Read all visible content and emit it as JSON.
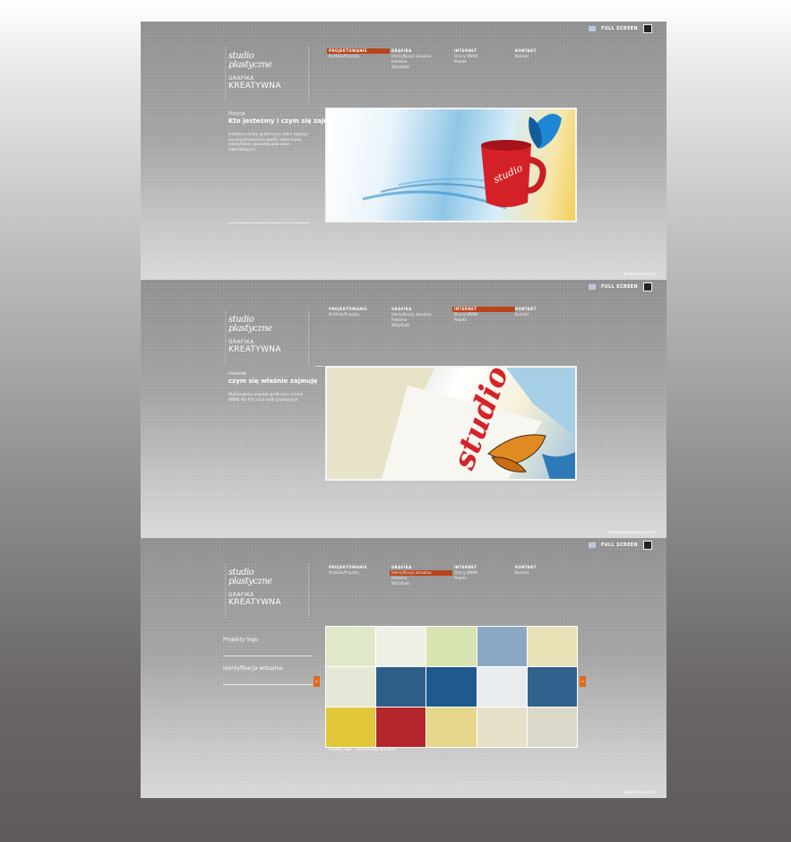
{
  "header": {
    "fullscreen_label": "FULL SCREEN"
  },
  "logo": {
    "script_line1": "studio",
    "script_line2": "plastyczne",
    "line1": "GRAFIKA",
    "line2": "KREATYWNA"
  },
  "nav": {
    "columns": [
      {
        "head": "PROJEKTOWANIE",
        "items": [
          "Portfolio/Projekty"
        ]
      },
      {
        "head": "GRAFIKA",
        "items": [
          "Identyfikacja wizualna",
          "Reklama",
          "Wizytówki"
        ]
      },
      {
        "head": "INTERNET",
        "items": [
          "Strony WWW",
          "Projekt"
        ]
      },
      {
        "head": "KONTAKT",
        "items": [
          "Kontakt"
        ]
      }
    ]
  },
  "panel1": {
    "kicker": "Pozycje",
    "title": "Kto jesteśmy i czym się zajmujemy",
    "body": "Jesteśmy studio graficznym, które zajmuje się projektowaniem grafiki reklamowej, identyfikacji wizualnej oraz stron internetowych.",
    "footer": "ISupra/Vincent/Cz"
  },
  "panel2": {
    "kicker": "Internet",
    "title": "czym się właśnie zajmuję",
    "body": "Wykonujemy projekty graficzne i strony WWW dla firm oraz osób prywatnych.",
    "footer": "kontakt@studioplastyczne"
  },
  "panel3": {
    "menu": [
      "Projekty logo",
      "Identyfikacja wizualna"
    ],
    "caption": "Projekty logo - identyfikacja wizualna",
    "footer": "ISupra/Vincent/Cz"
  },
  "colors": {
    "accent": "#b8441b",
    "arrow": "#e06a1a"
  },
  "gallery_tiles": [
    "#dfe9c8",
    "#eef0e6",
    "#d8e3b2",
    "#8aa8c2",
    "#e8e2b6",
    "#e4e8d6",
    "#2e5f88",
    "#1e5a8c",
    "#e8ecef",
    "#2f628c",
    "#e2c73a",
    "#b3262b",
    "#e5d68a",
    "#e6e0c9",
    "#dad8c8"
  ]
}
